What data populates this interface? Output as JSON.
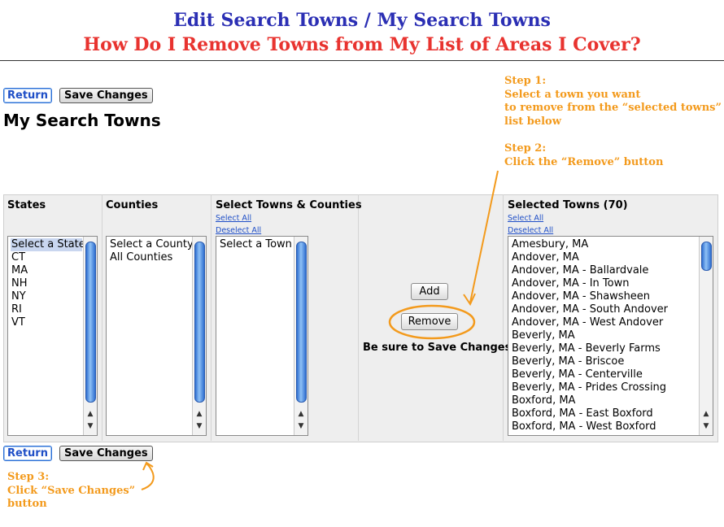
{
  "header": {
    "title_line1": "Edit Search Towns / My Search Towns",
    "title_line2": "How Do I Remove Towns from My List of Areas I Cover?"
  },
  "toolbar": {
    "return_label": "Return",
    "save_label": "Save Changes"
  },
  "page_title": "My Search Towns",
  "instructions": {
    "step1_label": "Step 1:",
    "step1_line1": "Select a town you want",
    "step1_line2": "to remove from the “selected towns”",
    "step1_line3": "list below",
    "step2_label": "Step 2:",
    "step2_line1": "Click the “Remove” button",
    "step3_label": "Step 3:",
    "step3_line1": "Click “Save Changes”",
    "step3_line2": "button"
  },
  "columns": {
    "states": {
      "header": "States",
      "options": [
        "Select a State",
        "CT",
        "MA",
        "NH",
        "NY",
        "RI",
        "VT"
      ],
      "selected": "Select a State"
    },
    "counties": {
      "header": "Counties",
      "options": [
        "Select a County",
        "All Counties"
      ]
    },
    "towns": {
      "header": "Select Towns & Counties",
      "select_all": "Select All",
      "deselect_all": "Deselect All",
      "options": [
        "Select a Town"
      ]
    },
    "selected_towns": {
      "header": "Selected Towns (70)",
      "select_all": "Select All",
      "deselect_all": "Deselect All",
      "options": [
        "Amesbury, MA",
        "Andover, MA",
        "Andover, MA - Ballardvale",
        "Andover, MA - In Town",
        "Andover, MA - Shawsheen",
        "Andover, MA - South Andover",
        "Andover, MA - West Andover",
        "Beverly, MA",
        "Beverly, MA - Beverly Farms",
        "Beverly, MA - Briscoe",
        "Beverly, MA - Centerville",
        "Beverly, MA - Prides Crossing",
        "Boxford, MA",
        "Boxford, MA - East Boxford",
        "Boxford, MA - West Boxford"
      ]
    }
  },
  "actions": {
    "add_label": "Add",
    "remove_label": "Remove",
    "reminder": "Be sure to Save Changes"
  },
  "colors": {
    "accent_orange": "#f39a1c",
    "title_blue": "#2b2fb4",
    "title_red": "#e8332f",
    "link_blue": "#1f4fc7"
  }
}
